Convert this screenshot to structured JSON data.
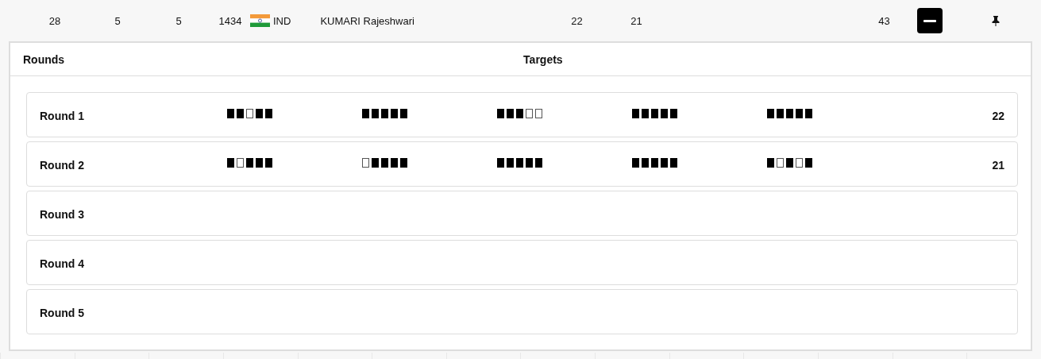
{
  "result_row": {
    "cells": [
      "28",
      "5",
      "5",
      "1434"
    ],
    "country": "IND",
    "athlete": "KUMARI Rajeshwari",
    "round_scores": [
      "22",
      "21"
    ],
    "total": "43",
    "expanded": true
  },
  "detail": {
    "columns": [
      "Rounds",
      "Targets"
    ],
    "rounds": [
      {
        "label": "Round 1",
        "score": "22",
        "targets": [
          [
            true,
            true,
            false,
            true,
            true
          ],
          [
            true,
            true,
            true,
            true,
            true
          ],
          [
            true,
            true,
            true,
            false,
            false
          ],
          [
            true,
            true,
            true,
            true,
            true
          ],
          [
            true,
            true,
            true,
            true,
            true
          ]
        ]
      },
      {
        "label": "Round 2",
        "score": "21",
        "targets": [
          [
            true,
            false,
            true,
            true,
            true
          ],
          [
            false,
            true,
            true,
            true,
            true
          ],
          [
            true,
            true,
            true,
            true,
            true
          ],
          [
            true,
            true,
            true,
            true,
            true
          ],
          [
            true,
            false,
            true,
            false,
            true
          ]
        ]
      },
      {
        "label": "Round 3"
      },
      {
        "label": "Round 4"
      },
      {
        "label": "Round 5"
      }
    ]
  }
}
